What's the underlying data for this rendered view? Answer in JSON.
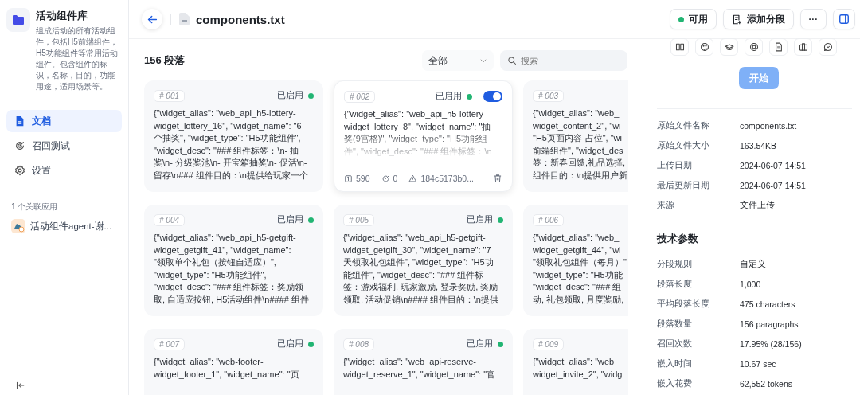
{
  "sidebar": {
    "title": "活动组件库",
    "description": "组成活动的所有活动组件，包括H5前端组件，H5功能组件等常用活动组件。包含组件的标识，名称，目的，功能用途，适用场景等。",
    "nav": [
      {
        "label": "文档",
        "selected": true
      },
      {
        "label": "召回测试",
        "selected": false
      },
      {
        "label": "设置",
        "selected": false
      }
    ],
    "related_label": "1 个关联应用",
    "apps": [
      {
        "name": "活动组件agent-谢..."
      }
    ]
  },
  "header": {
    "title": "components.txt",
    "status": {
      "label": "可用",
      "available": true
    },
    "add_button": "添加分段",
    "more_button": "···"
  },
  "list": {
    "count": "156 段落",
    "filter": "全部",
    "search_placeholder": "搜索",
    "segments": [
      {
        "number": "# 001",
        "status": "已启用",
        "enabled": true,
        "hovered": false,
        "lines": [
          "{\"widget_alias\": \"web_api_h5-lottery-",
          "widget_lottery_16\", \"widget_name\": \"6",
          "个抽奖\", \"widget_type\": \"H5功能组件\",",
          "\"widget_desc\": \"### 组件标签：\\n- 抽",
          "奖\\n- 分级奖池\\n- 开宝箱抽奖\\n- 促活\\n-",
          "留存\\n### 组件目的：\\n提供给玩家一个"
        ]
      },
      {
        "number": "# 002",
        "status": "已启用",
        "enabled": true,
        "hovered": true,
        "toggle": {
          "on": true
        },
        "stats": {
          "characters": "590",
          "hits": "0",
          "hash": "184c5173b0..."
        },
        "lines": [
          "{\"widget_alias\": \"web_api_h5-lottery-",
          "widget_lottery_8\", \"widget_name\": \"抽",
          "奖(9宫格)\", \"widget_type\": \"H5功能组",
          "件\", \"widget_desc\": \"### 组件标签：\\n"
        ]
      },
      {
        "number": "# 003",
        "hovered": false,
        "lines": [
          "{\"widget_alias\": \"web_",
          "widget_content_2\", \"wi",
          "\"H5页面内容-占位\", \"wi",
          "前端组件\", \"widget_des",
          "签：新春回馈,礼品选择,",
          "组件目的：\\n提供用户新"
        ]
      },
      {
        "number": "# 004",
        "status": "已启用",
        "enabled": true,
        "hovered": false,
        "lines": [
          "{\"widget_alias\": \"web_api_h5-getgift-",
          "widget_getgift_41\", \"widget_name\":",
          "\"领取单个礼包（按钮自适应）\",",
          "\"widget_type\": \"H5功能组件\",",
          "\"widget_desc\": \"### 组件标签：奖励领",
          "取, 自适应按钮, H5活动组件\\n#### 组件"
        ]
      },
      {
        "number": "# 005",
        "status": "已启用",
        "enabled": true,
        "hovered": false,
        "lines": [
          "{\"widget_alias\": \"web_api_h5-getgift-",
          "widget_getgift_30\", \"widget_name\": \"7",
          "天领取礼包组件\", \"widget_type\": \"H5功",
          "能组件\", \"widget_desc\": \"### 组件标",
          "签：游戏福利, 玩家激励, 登录奖励, 奖励",
          "领取, 活动促销\\n#### 组件目的：\\n提供"
        ]
      },
      {
        "number": "# 006",
        "hovered": false,
        "lines": [
          "{\"widget_alias\": \"web_",
          "widget_getgift_44\", \"wi",
          "\"领取礼包组件（每月）\"",
          "\"widget_type\": \"H5功能",
          "\"widget_desc\": \"### 组",
          "动, 礼包领取, 月度奖励,"
        ]
      },
      {
        "number": "# 007",
        "status": "已启用",
        "enabled": true,
        "hovered": false,
        "lines": [
          "{\"widget_alias\": \"web-footer-",
          "widget_footer_1\", \"widget_name\": \"页"
        ]
      },
      {
        "number": "# 008",
        "status": "已启用",
        "enabled": true,
        "hovered": false,
        "lines": [
          "{\"widget_alias\": \"web_api-reserve-",
          "widget_reserve_1\", \"widget_name\": \"官"
        ]
      },
      {
        "number": "# 009",
        "hovered": false,
        "lines": [
          "{\"widget_alias\": \"web_",
          "widget_invite_2\", \"widg"
        ]
      }
    ]
  },
  "panel": {
    "start_button": {
      "label": "开始",
      "disabled": true
    },
    "info": [
      {
        "label": "原始文件名称",
        "value": "components.txt"
      },
      {
        "label": "原始文件大小",
        "value": "163.54KB"
      },
      {
        "label": "上传日期",
        "value": "2024-06-07 14:51"
      },
      {
        "label": "最后更新日期",
        "value": "2024-06-07 14:51"
      },
      {
        "label": "来源",
        "value": "文件上传"
      }
    ],
    "params_title": "技术参数",
    "params": [
      {
        "label": "分段规则",
        "value": "自定义"
      },
      {
        "label": "段落长度",
        "value": "1,000"
      },
      {
        "label": "平均段落长度",
        "value": "475 characters"
      },
      {
        "label": "段落数量",
        "value": "156 paragraphs"
      },
      {
        "label": "召回次数",
        "value": "17.95% (28/156)"
      },
      {
        "label": "嵌入时间",
        "value": "10.67 sec"
      },
      {
        "label": "嵌入花费",
        "value": "62,552 tokens"
      }
    ]
  }
}
